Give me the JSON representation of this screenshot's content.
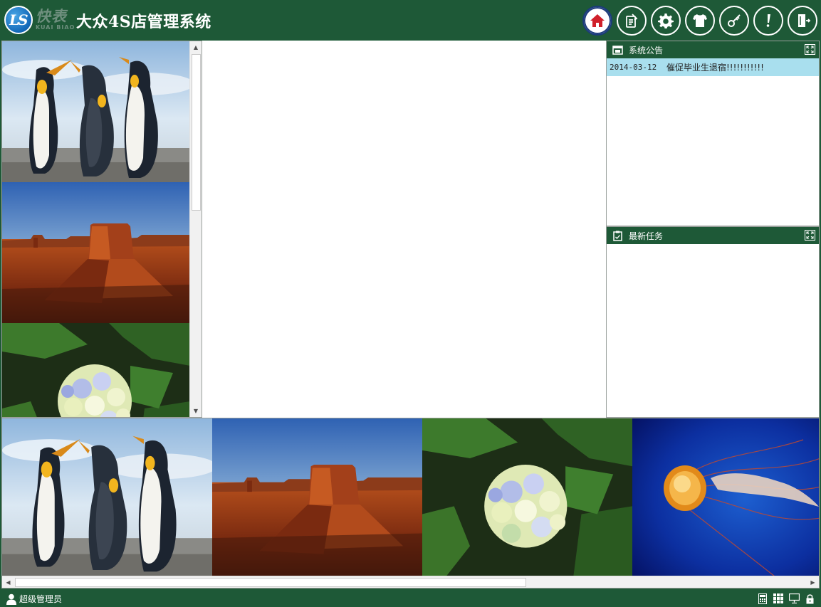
{
  "header": {
    "logo_cn": "快表",
    "logo_en": "KUAI BIAO",
    "title": "大众4S店管理系统",
    "toolbar": [
      {
        "icon": "home-icon",
        "active": true
      },
      {
        "icon": "edit-document-icon"
      },
      {
        "icon": "gear-icon"
      },
      {
        "icon": "shirt-icon"
      },
      {
        "icon": "key-icon"
      },
      {
        "icon": "exclamation-icon"
      },
      {
        "icon": "logout-icon"
      }
    ]
  },
  "image_column": {
    "tiles": [
      {
        "icon": "penguins-image"
      },
      {
        "icon": "desert-image"
      },
      {
        "icon": "hydrangea-image"
      }
    ]
  },
  "notice_panel": {
    "title": "系统公告",
    "rows": [
      {
        "date": "2014-03-12",
        "text": "催促毕业生退宿!!!!!!!!!!!"
      }
    ]
  },
  "task_panel": {
    "title": "最新任务"
  },
  "gallery": {
    "tiles": [
      {
        "icon": "penguins-image"
      },
      {
        "icon": "desert-image"
      },
      {
        "icon": "hydrangea-image"
      },
      {
        "icon": "jellyfish-image"
      }
    ]
  },
  "statusbar": {
    "user": "超级管理员",
    "icons": [
      "calculator-icon",
      "grid-icon",
      "monitor-icon",
      "lock-icon"
    ]
  },
  "colors": {
    "brand_green": "#1e5937",
    "notice_highlight": "#a9dfee",
    "active_ring": "#1b3b7a",
    "home_red": "#d0202a"
  }
}
